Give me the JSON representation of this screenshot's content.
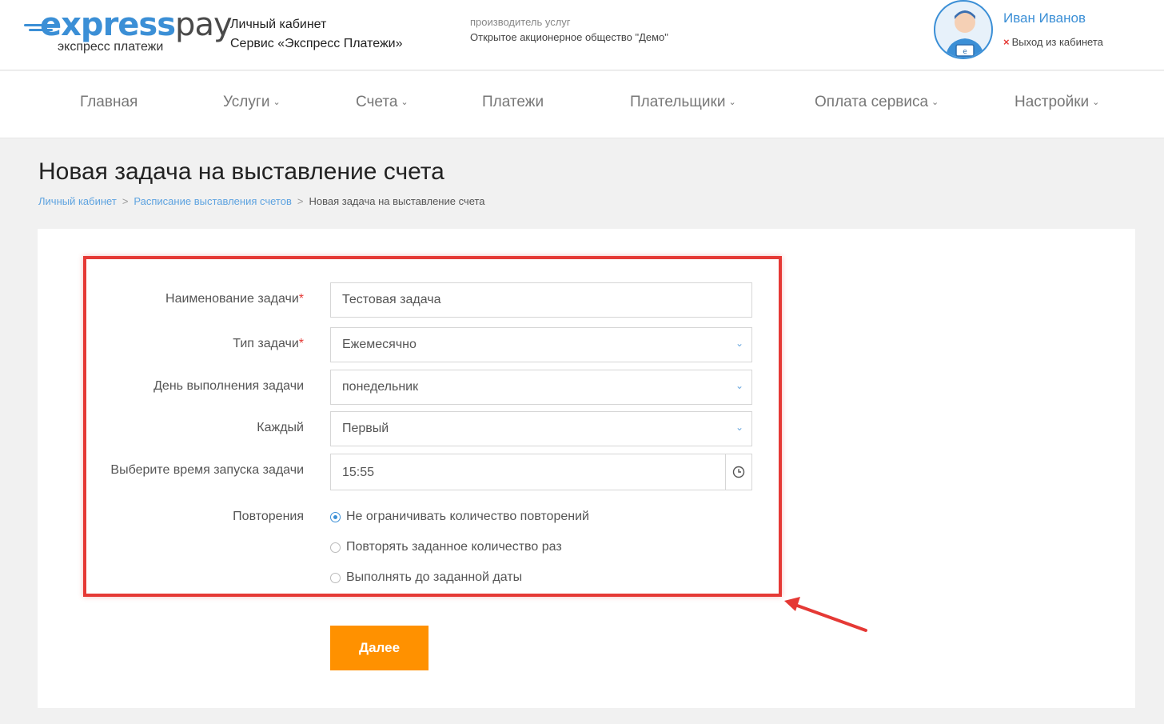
{
  "brand": {
    "name_part1": "express",
    "name_part2": "pay",
    "subtitle": "экспресс платежи"
  },
  "cabinet": {
    "line1": "Личный кабинет",
    "line2": "Сервис «Экспресс Платежи»"
  },
  "provider": {
    "caption": "производитель услуг",
    "org": "Открытое акционерное общество \"Демо\""
  },
  "user": {
    "name": "Иван Иванов",
    "logout_icon": "×",
    "logout_label": "Выход из кабинета"
  },
  "nav": {
    "home": "Главная",
    "services": "Услуги",
    "invoices": "Счета",
    "payments": "Платежи",
    "payers": "Плательщики",
    "service_payment": "Оплата сервиса",
    "settings": "Настройки",
    "chevron": "⌄"
  },
  "page": {
    "title": "Новая задача на выставление счета"
  },
  "breadcrumb": {
    "item1": "Личный кабинет",
    "item2": "Расписание выставления счетов",
    "item3": "Новая задача на выставление счета",
    "sep": ">"
  },
  "form": {
    "required_mark": "*",
    "task_name": {
      "label": "Наименование задачи",
      "value": "Тестовая задача"
    },
    "task_type": {
      "label": "Тип задачи",
      "value": "Ежемесячно"
    },
    "exec_day": {
      "label": "День выполнения задачи",
      "value": "понедельник"
    },
    "every": {
      "label": "Каждый",
      "value": "Первый"
    },
    "start_time": {
      "label": "Выберите время запуска задачи",
      "value": "15:55"
    },
    "repeats": {
      "label": "Повторения",
      "options": [
        {
          "label": "Не ограничивать количество повторений",
          "checked": true
        },
        {
          "label": "Повторять заданное количество раз",
          "checked": false
        },
        {
          "label": "Выполнять до заданной даты",
          "checked": false
        }
      ]
    },
    "dropdown_icon": "⌄",
    "next_button": "Далее"
  },
  "colors": {
    "accent": "#3b8fd6",
    "button": "#ff9100",
    "highlight": "#e53935"
  }
}
